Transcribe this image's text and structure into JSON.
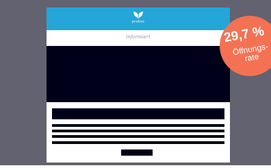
{
  "email": {
    "brand": "profino",
    "subheader": "informiert"
  },
  "badge": {
    "value": "29,7 %",
    "label_line1": "Öffnungs-",
    "label_line2": "rate"
  },
  "colors": {
    "background": "#636270",
    "header": "#24a6d8",
    "content_blocks": "#00001a",
    "badge": "#f47253"
  },
  "icons": {
    "logo": "butterfly-logo-icon"
  }
}
